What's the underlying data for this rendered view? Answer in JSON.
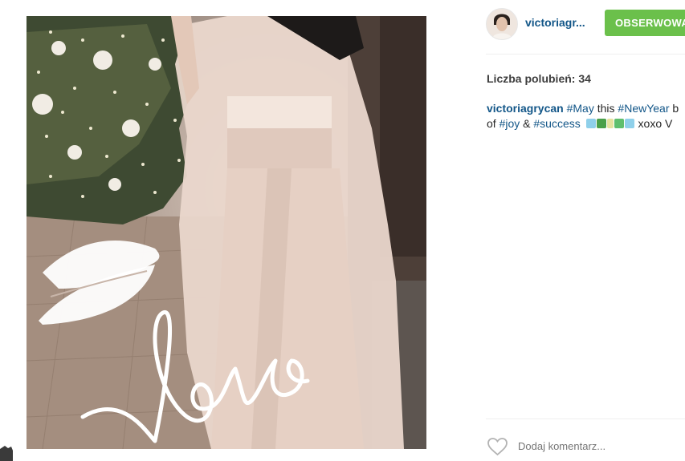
{
  "post": {
    "photo_icon": "photo-image",
    "love_text": "love"
  },
  "header": {
    "username": "victoriagr...",
    "follow_label": "OBSERWOWA",
    "follow_color": "#6bc04b"
  },
  "likes": {
    "text": "Liczba polubień: 34"
  },
  "caption": {
    "username": "victoriagrycan",
    "line1": [
      {
        "t": "#May",
        "tag": true
      },
      {
        "t": " this ",
        "tag": false
      },
      {
        "t": "#NewYear",
        "tag": true
      },
      {
        "t": " b",
        "tag": false
      }
    ],
    "line2_prefix": "of ",
    "line2_tag1": "#joy",
    "line2_amp": " & ",
    "line2_tag2": "#success",
    "line2_suffix": " xoxo V"
  },
  "comment": {
    "placeholder": "Dodaj komentarz...",
    "heart_icon": "heart-outline-icon"
  },
  "colors": {
    "link": "#125688",
    "button": "#6bc04b"
  }
}
